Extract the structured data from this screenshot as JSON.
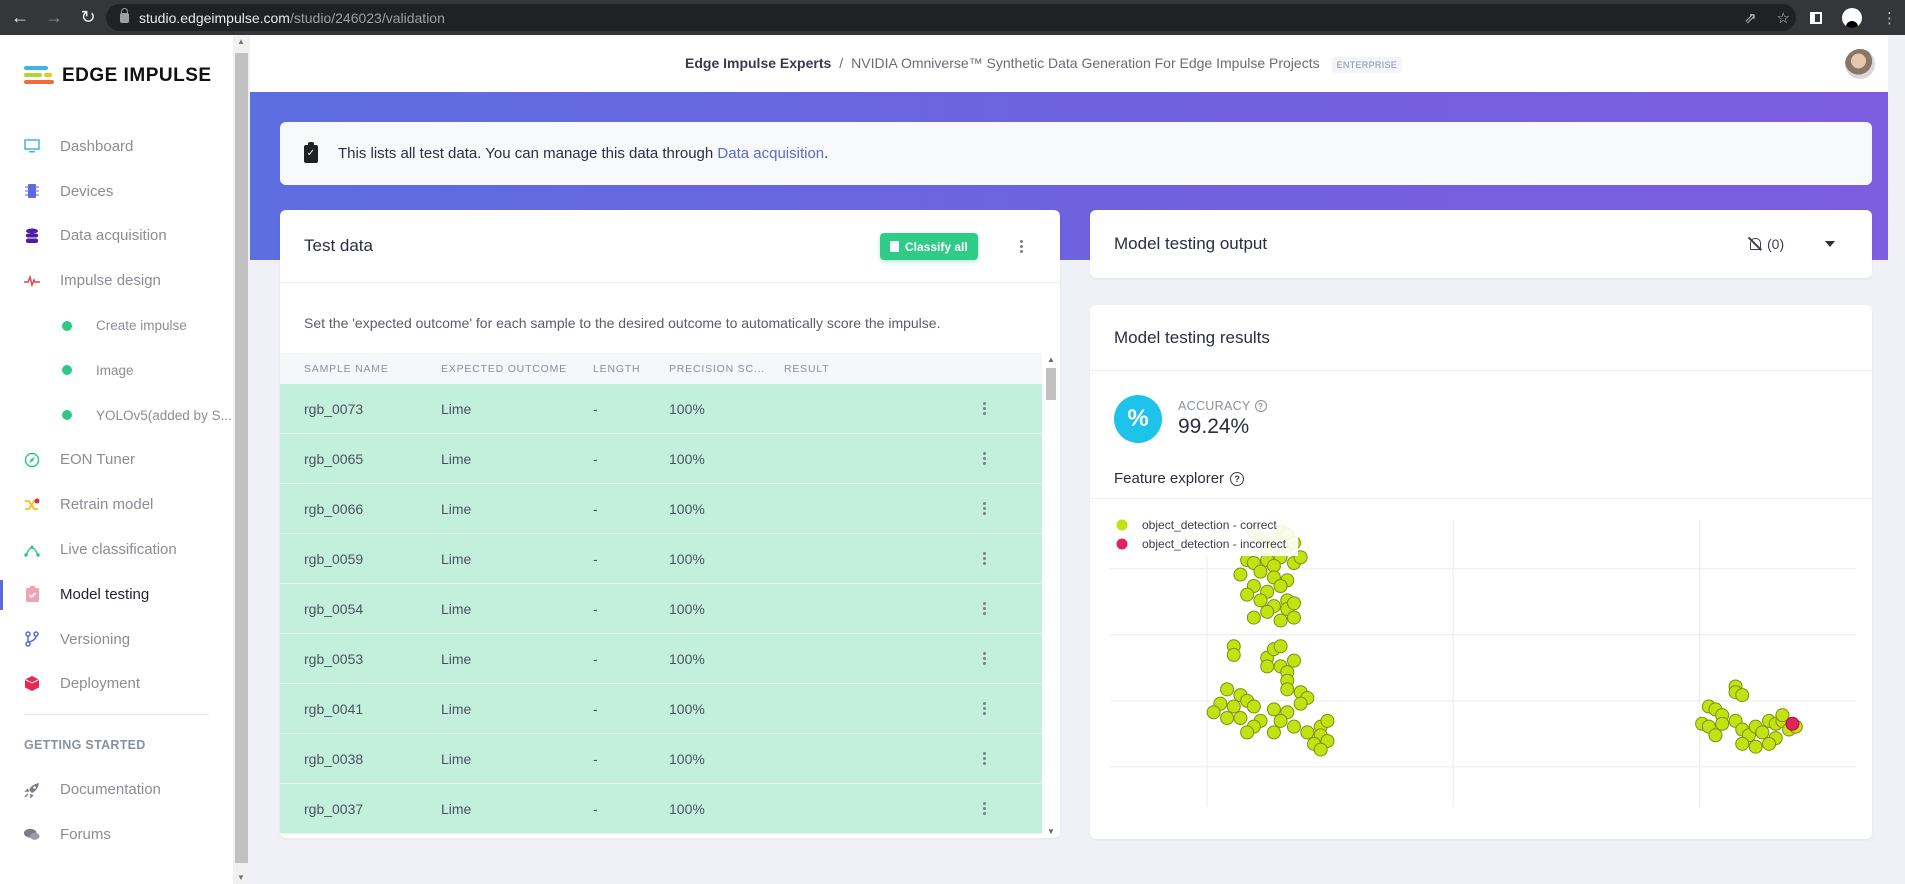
{
  "browser": {
    "url_host": "studio.edgeimpulse.com",
    "url_path": "/studio/246023/validation"
  },
  "sidebar": {
    "logo_text": "EDGE IMPULSE",
    "items": [
      {
        "label": "Dashboard",
        "icon": "monitor-icon",
        "color": "#3fb6e0"
      },
      {
        "label": "Devices",
        "icon": "chip-icon",
        "color": "#5b6ae0"
      },
      {
        "label": "Data acquisition",
        "icon": "database-icon",
        "color": "#4b1fa0"
      },
      {
        "label": "Impulse design",
        "icon": "pulse-icon",
        "color": "#e3414b"
      },
      {
        "label": "Create impulse",
        "icon": "status-dot",
        "sub": true
      },
      {
        "label": "Image",
        "icon": "status-dot",
        "sub": true
      },
      {
        "label": "YOLOv5(added by S...",
        "icon": "status-dot",
        "sub": true
      },
      {
        "label": "EON Tuner",
        "icon": "compass-icon",
        "color": "#2dc986"
      },
      {
        "label": "Retrain model",
        "icon": "shuffle-icon",
        "color": "#f2c21a"
      },
      {
        "label": "Live classification",
        "icon": "live-icon",
        "color": "#2dc986"
      },
      {
        "label": "Model testing",
        "icon": "clipboard-check-icon",
        "color": "#f1a3b5",
        "active": true
      },
      {
        "label": "Versioning",
        "icon": "branch-icon",
        "color": "#5b6ae0"
      },
      {
        "label": "Deployment",
        "icon": "box-icon",
        "color": "#e8284e"
      }
    ],
    "section_heading": "GETTING STARTED",
    "getting_started": [
      {
        "label": "Documentation",
        "icon": "rocket-icon"
      },
      {
        "label": "Forums",
        "icon": "chat-icon"
      }
    ]
  },
  "header": {
    "org": "Edge Impulse Experts",
    "separator": "/",
    "project": "NVIDIA Omniverse™ Synthetic Data Generation For Edge Impulse Projects",
    "badge": "ENTERPRISE"
  },
  "info": {
    "text": "This lists all test data. You can manage this data through ",
    "link": "Data acquisition",
    "suffix": "."
  },
  "test_data": {
    "title": "Test data",
    "classify_all": "Classify all",
    "description": "Set the 'expected outcome' for each sample to the desired outcome to automatically score the impulse.",
    "columns": [
      "SAMPLE NAME",
      "EXPECTED OUTCOME",
      "LENGTH",
      "PRECISION SC...",
      "RESULT"
    ],
    "rows": [
      {
        "name": "rgb_0073",
        "expected": "Lime",
        "length": "-",
        "precision": "100%",
        "result": ""
      },
      {
        "name": "rgb_0065",
        "expected": "Lime",
        "length": "-",
        "precision": "100%",
        "result": ""
      },
      {
        "name": "rgb_0066",
        "expected": "Lime",
        "length": "-",
        "precision": "100%",
        "result": ""
      },
      {
        "name": "rgb_0059",
        "expected": "Lime",
        "length": "-",
        "precision": "100%",
        "result": ""
      },
      {
        "name": "rgb_0054",
        "expected": "Lime",
        "length": "-",
        "precision": "100%",
        "result": ""
      },
      {
        "name": "rgb_0053",
        "expected": "Lime",
        "length": "-",
        "precision": "100%",
        "result": ""
      },
      {
        "name": "rgb_0041",
        "expected": "Lime",
        "length": "-",
        "precision": "100%",
        "result": ""
      },
      {
        "name": "rgb_0038",
        "expected": "Lime",
        "length": "-",
        "precision": "100%",
        "result": ""
      },
      {
        "name": "rgb_0037",
        "expected": "Lime",
        "length": "-",
        "precision": "100%",
        "result": ""
      }
    ],
    "row_color": "#c3f0dc"
  },
  "output": {
    "title": "Model testing output",
    "notification_count": "(0)"
  },
  "results": {
    "title": "Model testing results",
    "accuracy_label": "ACCURACY",
    "accuracy_value": "99.24%",
    "accuracy_icon": "%",
    "feature_explorer_title": "Feature explorer",
    "legend": [
      {
        "label": "object_detection - correct",
        "color": "#c2e312"
      },
      {
        "label": "object_detection - incorrect",
        "color": "#e0245e"
      }
    ]
  },
  "chart_data": {
    "type": "scatter",
    "title": "Feature explorer",
    "legend_position": "top-left",
    "grid": true,
    "xlim": [
      0,
      100
    ],
    "ylim": [
      0,
      100
    ],
    "series": [
      {
        "name": "object_detection - correct",
        "color": "#c2e312",
        "points": [
          [
            20,
            96
          ],
          [
            24,
            96
          ],
          [
            25,
            95
          ],
          [
            21,
            93
          ],
          [
            23,
            92
          ],
          [
            22,
            89
          ],
          [
            25,
            91
          ],
          [
            26,
            92
          ],
          [
            19,
            86
          ],
          [
            20,
            85
          ],
          [
            22,
            86
          ],
          [
            24,
            87
          ],
          [
            23,
            84
          ],
          [
            26,
            85
          ],
          [
            27,
            87
          ],
          [
            18,
            81
          ],
          [
            21,
            82
          ],
          [
            23,
            80
          ],
          [
            25,
            79
          ],
          [
            24,
            77
          ],
          [
            20,
            77
          ],
          [
            22,
            75
          ],
          [
            25,
            72
          ],
          [
            21,
            72
          ],
          [
            23,
            70
          ],
          [
            22,
            68
          ],
          [
            25,
            69
          ],
          [
            26,
            71
          ],
          [
            19,
            74
          ],
          [
            24,
            65
          ],
          [
            20,
            66
          ],
          [
            26,
            66
          ],
          [
            17,
            56
          ],
          [
            17,
            53
          ],
          [
            22,
            52
          ],
          [
            23,
            55
          ],
          [
            24,
            56
          ],
          [
            22,
            49
          ],
          [
            24,
            49
          ],
          [
            26,
            51
          ],
          [
            25,
            47
          ],
          [
            25,
            44
          ],
          [
            16,
            41
          ],
          [
            18,
            39
          ],
          [
            19,
            37
          ],
          [
            20,
            35
          ],
          [
            17,
            35
          ],
          [
            15,
            36
          ],
          [
            14,
            33
          ],
          [
            16,
            31
          ],
          [
            18,
            31
          ],
          [
            21,
            30
          ],
          [
            23,
            34
          ],
          [
            20,
            28
          ],
          [
            19,
            26
          ],
          [
            23,
            26
          ],
          [
            25,
            41
          ],
          [
            27,
            40
          ],
          [
            28,
            38
          ],
          [
            27,
            36
          ],
          [
            25,
            33
          ],
          [
            24,
            30
          ],
          [
            26,
            28
          ],
          [
            28,
            26
          ],
          [
            30,
            28
          ],
          [
            31,
            30
          ],
          [
            30,
            25
          ],
          [
            31,
            23
          ],
          [
            29,
            22
          ],
          [
            30,
            20
          ],
          [
            88,
            35
          ],
          [
            89,
            34
          ],
          [
            90,
            32
          ],
          [
            87,
            29
          ],
          [
            88,
            28
          ],
          [
            90,
            29
          ],
          [
            89,
            25
          ],
          [
            92,
            30
          ],
          [
            93,
            27
          ],
          [
            94,
            25
          ],
          [
            95,
            28
          ],
          [
            96,
            26
          ],
          [
            97,
            30
          ],
          [
            98,
            29
          ],
          [
            99,
            30
          ],
          [
            100,
            27
          ],
          [
            98,
            24
          ],
          [
            97,
            22
          ],
          [
            95,
            21
          ],
          [
            93,
            22
          ],
          [
            99,
            32
          ],
          [
            101,
            28
          ],
          [
            92,
            42
          ],
          [
            92,
            40
          ],
          [
            93,
            39
          ]
        ]
      },
      {
        "name": "object_detection - incorrect",
        "color": "#e0245e",
        "points": [
          [
            100.5,
            29
          ]
        ]
      }
    ]
  }
}
